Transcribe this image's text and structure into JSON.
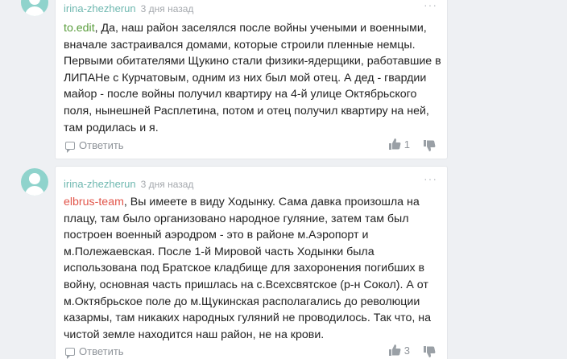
{
  "comments": [
    {
      "author": "irina-zhezherun",
      "time": "3 дня назад",
      "more": "···",
      "mention": "to.edit",
      "text": ", Да, наш район заселялся после войны учеными и военными, вначале застраивался домами, которые строили пленные немцы. Первыми обитателями Щукино стали физики-ядерщики, работавшие в ЛИПАНе с Курчатовым, одним из них был мой отец. А дед - гвардии майор - после войны получил квартиру на 4-й улице Октябрьского поля, нынешней Расплетина, потом и отец получил квартиру на ней, там родилась и я.",
      "reply_label": "Ответить",
      "likes": "1"
    },
    {
      "author": "irina-zhezherun",
      "time": "3 дня назад",
      "more": "···",
      "mention": "elbrus-team",
      "text": ", Вы имеете в виду Ходынку. Сама давка произошла на плацу, там было организовано народное гуляние, затем там был построен военный аэродром - это в районе м.Аэропорт и м.Полежаевская. После 1-й Мировой часть Ходынки была использована под Братское кладбище для захоронения погибших в войну, основная часть пришлась на с.Всехсвятское (р-н Сокол). А от м.Октябрьское поле до м.Щукинская располагались до революции казармы, там никаких народных гуляний не проводилось. Так что, на чистой земле находится наш район, не на крови.",
      "reply_label": "Ответить",
      "likes": "3"
    }
  ],
  "colors": {
    "author": "#6fb8b0",
    "mention_1": "#5a9d3d",
    "mention_2": "#e2564b",
    "avatar": "#8fd3cc"
  },
  "icons": [
    "user-avatar-icon",
    "reply-icon",
    "thumbs-up-icon",
    "thumbs-down-icon",
    "more-dots-icon"
  ]
}
